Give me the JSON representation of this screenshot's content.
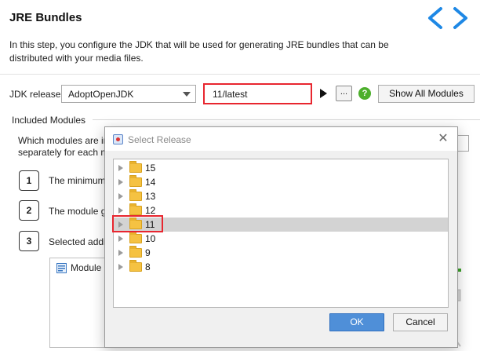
{
  "header": {
    "title": "JRE Bundles",
    "description": "In this step, you configure the JDK that will be used for generating JRE bundles that can be distributed with your media files."
  },
  "jdk": {
    "label": "JDK release:",
    "vendor": "AdoptOpenJDK",
    "release": "11/latest",
    "more_label": "...",
    "help_label": "?",
    "show_all_label": "Show All Modules"
  },
  "modules": {
    "section_title": "Included Modules",
    "question_line1": "Which modules are in",
    "question_line2": "separately for each m",
    "steps": [
      {
        "num": "1",
        "text": "The minimum"
      },
      {
        "num": "2",
        "text": "The module g"
      },
      {
        "num": "3",
        "text": "Selected additi"
      }
    ],
    "list_header": "Module"
  },
  "dialog": {
    "title": "Select Release",
    "releases": [
      "15",
      "14",
      "13",
      "12",
      "11",
      "10",
      "9",
      "8"
    ],
    "selected": "11",
    "ok_label": "OK",
    "cancel_label": "Cancel"
  },
  "colors": {
    "highlight": "#e8262f",
    "accent": "#1e88e5",
    "ok_button": "#4f8fd8",
    "help": "#4caf2b",
    "folder": "#f5c242"
  }
}
